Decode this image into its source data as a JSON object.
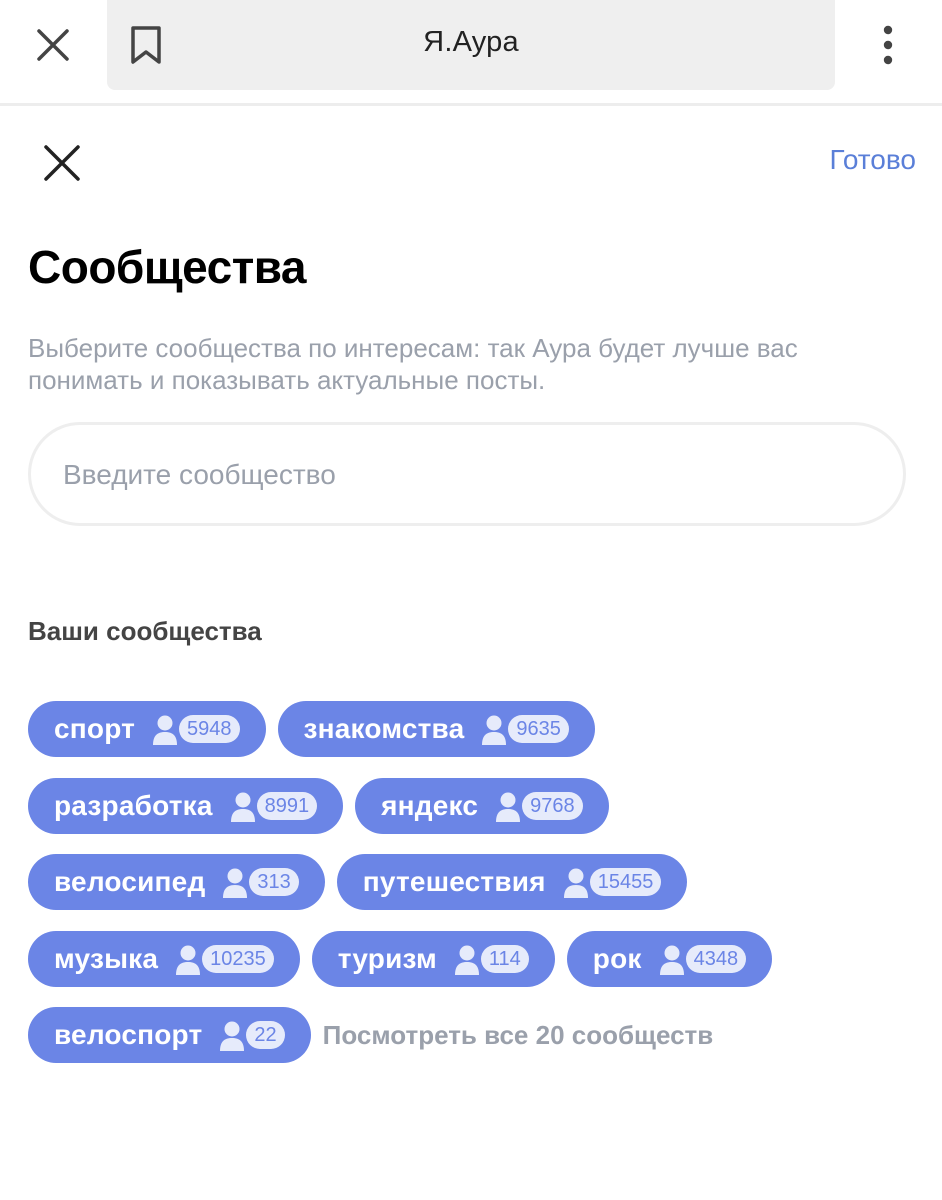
{
  "browser": {
    "url_title": "Я.Аура"
  },
  "header": {
    "done_label": "Готово"
  },
  "page": {
    "title": "Сообщества",
    "description": "Выберите сообщества по интересам: так Аура будет лучше вас понимать и показывать актуальные посты.",
    "search_placeholder": "Введите сообщество",
    "section_title": "Ваши сообщества",
    "see_all_label": "Посмотреть все 20 сообществ"
  },
  "communities": [
    {
      "label": "спорт",
      "count": "5948"
    },
    {
      "label": "знакомства",
      "count": "9635"
    },
    {
      "label": "разработка",
      "count": "8991"
    },
    {
      "label": "яндекс",
      "count": "9768"
    },
    {
      "label": "велосипед",
      "count": "313"
    },
    {
      "label": "путешествия",
      "count": "15455"
    },
    {
      "label": "музыка",
      "count": "10235"
    },
    {
      "label": "туризм",
      "count": "114"
    },
    {
      "label": "рок",
      "count": "4348"
    },
    {
      "label": "велоспорт",
      "count": "22"
    }
  ],
  "colors": {
    "chip_bg": "#6b85e6",
    "chip_count_bg": "#e6ebfb",
    "link": "#5a7fd8",
    "muted_text": "#9aa0ab"
  },
  "icons": [
    "close-icon",
    "bookmark-icon",
    "more-vertical-icon",
    "user-icon"
  ]
}
